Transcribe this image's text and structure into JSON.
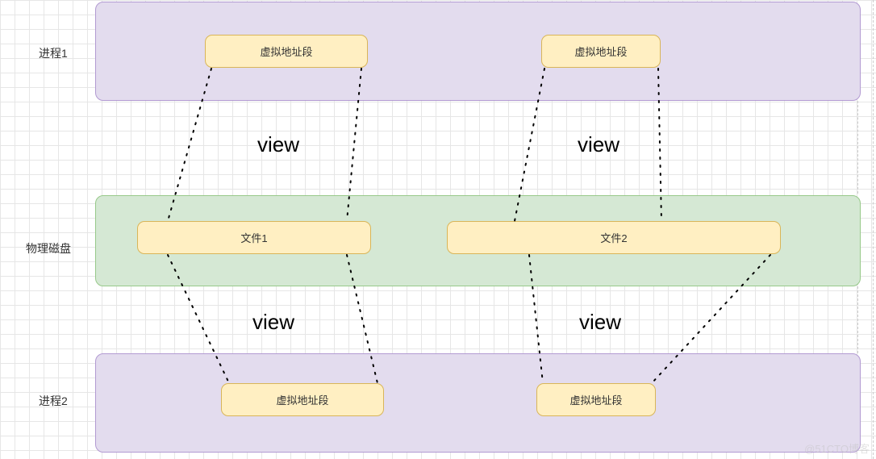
{
  "labels": {
    "process1": "进程1",
    "process2": "进程2",
    "disk": "物理磁盘"
  },
  "boxes": {
    "virtAddrSeg": "虚拟地址段",
    "file1": "文件1",
    "file2": "文件2"
  },
  "connectors": {
    "viewTopLeft": "view",
    "viewTopRight": "view",
    "viewBottomLeft": "view",
    "viewBottomRight": "view"
  },
  "watermark": "@51CTO博客"
}
